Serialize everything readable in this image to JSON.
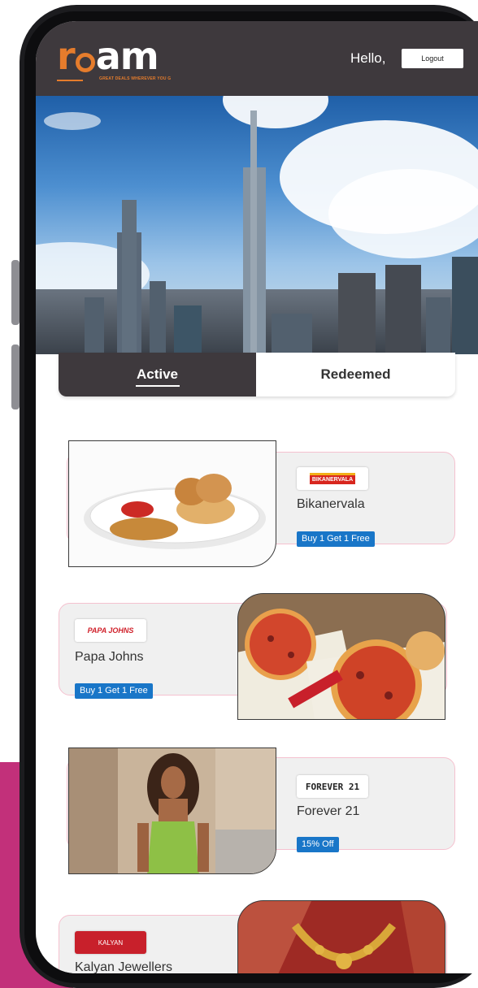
{
  "header": {
    "logo_text": "roam",
    "tagline": "GREAT DEALS WHEREVER YOU G",
    "greeting": "Hello,",
    "logout_label": "Logout"
  },
  "tabs": [
    {
      "label": "Active",
      "selected": true
    },
    {
      "label": "Redeemed",
      "selected": false
    }
  ],
  "deals": [
    {
      "brand": "Bikanervala",
      "logo_text": "BIKANERVALA",
      "offer": "Buy 1 Get 1 Free",
      "photo": "pav-bhaji-plate"
    },
    {
      "brand": "Papa Johns",
      "logo_text": "PAPA JOHNS",
      "offer": "Buy 1 Get 1 Free",
      "photo": "pizza-boxes"
    },
    {
      "brand": "Forever 21",
      "logo_text": "FOREVER 21",
      "offer": "15% Off",
      "photo": "model-street"
    },
    {
      "brand": "Kalyan Jewellers",
      "logo_text": "KALYAN",
      "offer": "",
      "photo": "gold-necklace"
    }
  ],
  "colors": {
    "header": "#3e393d",
    "accent": "#e57c2c",
    "offer": "#1976c8",
    "card_border": "#f5c1cf"
  }
}
